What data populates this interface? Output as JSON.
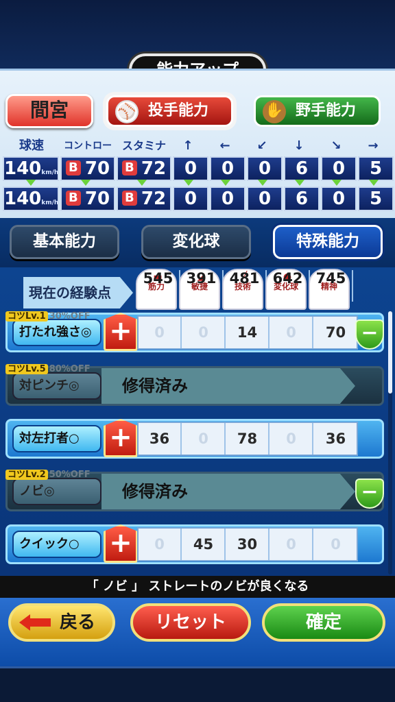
{
  "title": "能力アップ",
  "player_name": "間宮",
  "tabs": [
    {
      "label": "投手能力",
      "icon": "baseball-icon",
      "active": true
    },
    {
      "label": "野手能力",
      "icon": "glove-icon",
      "active": false
    }
  ],
  "stats": {
    "headers": [
      "球速",
      "コントロール",
      "スタミナ",
      "↑",
      "←",
      "↙",
      "↓",
      "↘",
      "→"
    ],
    "current": {
      "speed": "140",
      "speed_unit": "km/h",
      "control_rank": "B",
      "control": "70",
      "stamina_rank": "B",
      "stamina": "72",
      "dirs": [
        "0",
        "0",
        "0",
        "6",
        "0",
        "5"
      ]
    },
    "after": {
      "speed": "140",
      "speed_unit": "km/h",
      "control_rank": "B",
      "control": "70",
      "stamina_rank": "B",
      "stamina": "72",
      "dirs": [
        "0",
        "0",
        "0",
        "6",
        "0",
        "5"
      ]
    }
  },
  "sub_tabs": [
    {
      "label": "基本能力",
      "active": false
    },
    {
      "label": "変化球",
      "active": false
    },
    {
      "label": "特殊能力",
      "active": true
    }
  ],
  "experience": {
    "label": "現在の経験点",
    "columns": [
      {
        "name": "筋力",
        "value": "545"
      },
      {
        "name": "敏捷",
        "value": "391"
      },
      {
        "name": "技術",
        "value": "481"
      },
      {
        "name": "変化球",
        "value": "642"
      },
      {
        "name": "精神",
        "value": "745"
      }
    ]
  },
  "skills": [
    {
      "name": "打たれ強さ◎",
      "kotsu": "コツLv.1",
      "off": "30%OFF",
      "learned": false,
      "costs": [
        "0",
        "0",
        "14",
        "0",
        "70"
      ],
      "minus": true
    },
    {
      "name": "対ピンチ◎",
      "kotsu": "コツLv.5",
      "off": "80%OFF",
      "learned": true,
      "learned_text": "修得済み",
      "minus": false
    },
    {
      "name": "対左打者○",
      "kotsu": "",
      "off": "",
      "learned": false,
      "costs": [
        "36",
        "0",
        "78",
        "0",
        "36"
      ],
      "minus": false
    },
    {
      "name": "ノビ◎",
      "kotsu": "コツLv.2",
      "off": "50%OFF",
      "learned": true,
      "learned_text": "修得済み",
      "minus": true
    },
    {
      "name": "クイック○",
      "kotsu": "",
      "off": "",
      "learned": false,
      "costs": [
        "0",
        "45",
        "30",
        "0",
        "0"
      ],
      "minus": false
    }
  ],
  "description": "「 ノビ 」 ストレートのノビが良くなる",
  "buttons": {
    "back": "戻る",
    "reset": "リセット",
    "confirm": "確定"
  }
}
